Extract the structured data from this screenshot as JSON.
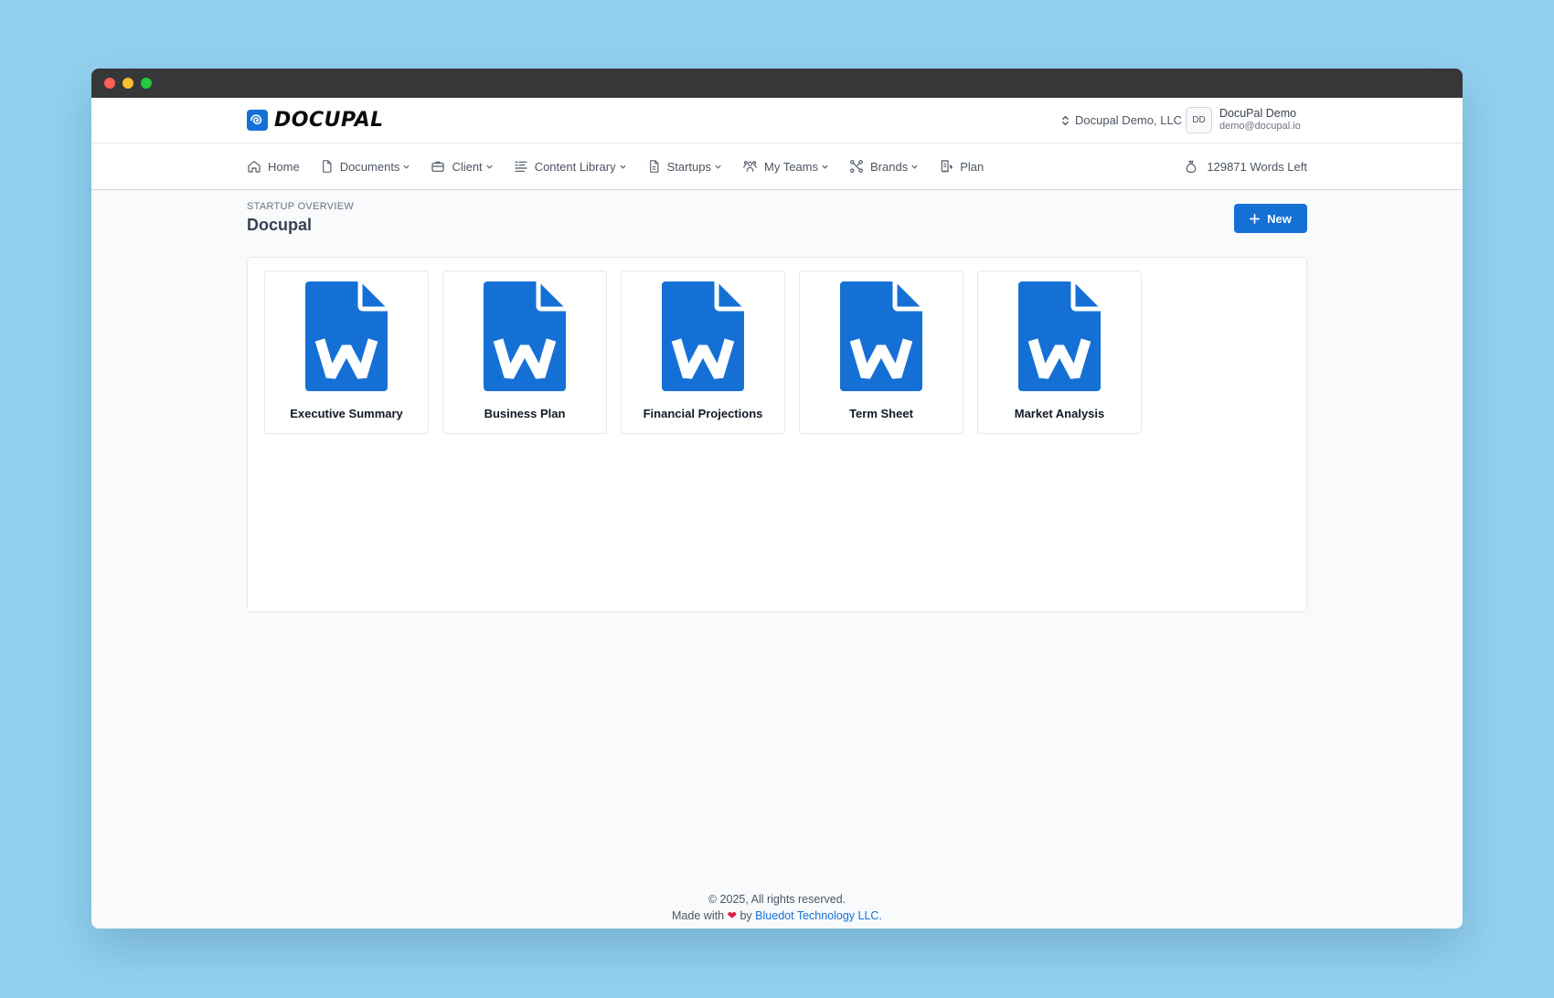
{
  "header": {
    "logo_text": "DOCUPAL",
    "org_name": "Docupal Demo, LLC",
    "avatar_initials": "DD",
    "user_name": "DocuPal Demo",
    "user_email": "demo@docupal.io"
  },
  "nav": {
    "items": [
      {
        "label": "Home"
      },
      {
        "label": "Documents"
      },
      {
        "label": "Client"
      },
      {
        "label": "Content Library"
      },
      {
        "label": "Startups"
      },
      {
        "label": "My Teams"
      },
      {
        "label": "Brands"
      },
      {
        "label": "Plan"
      }
    ],
    "words_left": "129871 Words Left"
  },
  "page": {
    "eyebrow": "STARTUP OVERVIEW",
    "title": "Docupal",
    "new_button": "New"
  },
  "documents": [
    {
      "label": "Executive Summary",
      "icon": "word-document-icon"
    },
    {
      "label": "Business Plan",
      "icon": "word-document-icon"
    },
    {
      "label": "Financial Projections",
      "icon": "word-document-icon"
    },
    {
      "label": "Term Sheet",
      "icon": "word-document-icon"
    },
    {
      "label": "Market Analysis",
      "icon": "word-document-icon"
    }
  ],
  "footer": {
    "copyright": "© 2025, All rights reserved.",
    "made_with": "Made with",
    "by": "by",
    "company_link": "Bluedot Technology LLC."
  },
  "colors": {
    "accent": "#1570d6",
    "background": "#93d1ef",
    "heart": "#e11d48"
  }
}
